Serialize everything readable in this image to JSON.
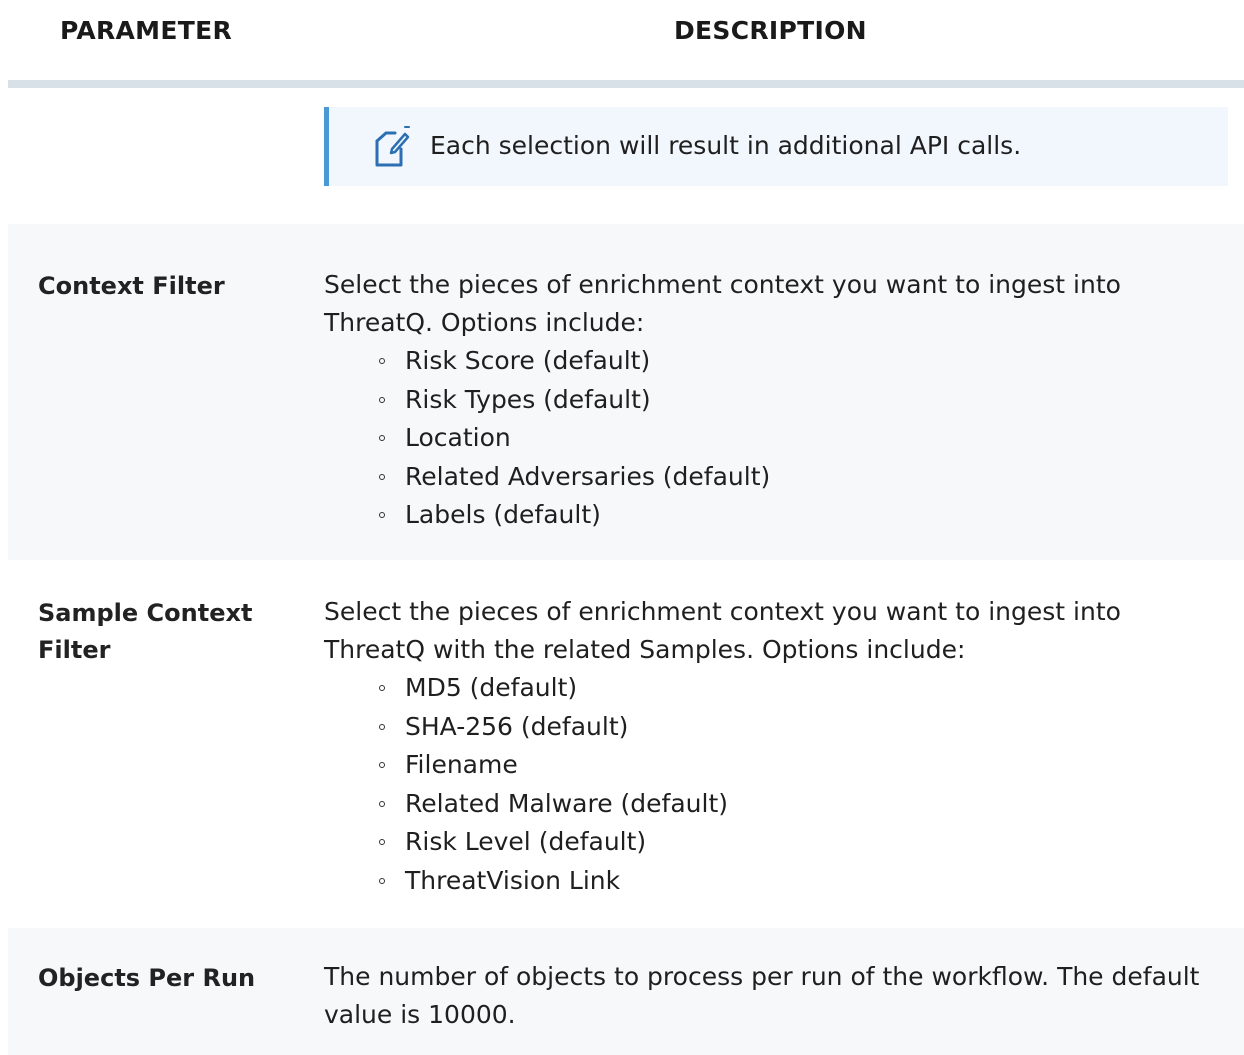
{
  "header": {
    "parameter": "PARAMETER",
    "description": "DESCRIPTION"
  },
  "note": {
    "icon": "note-edit-icon",
    "text": "Each selection will result in additional API calls."
  },
  "colors": {
    "note_border": "#4a98d6",
    "note_background": "#f1f7fc",
    "row_shade": "#f6f8fa",
    "header_rule": "#d9e1e8"
  },
  "rows": [
    {
      "parameter": "Context Filter",
      "description": "Select the pieces of enrichment context you want to ingest into ThreatQ.  Options include:",
      "options": [
        "Risk Score (default)",
        "Risk Types (default)",
        "Location",
        "Related Adversaries (default)",
        "Labels (default)"
      ]
    },
    {
      "parameter": "Sample Context Filter",
      "description": "Select the pieces of enrichment context you want to ingest into ThreatQ with the related Samples.  Options include:",
      "options": [
        "MD5 (default)",
        "SHA-256 (default)",
        "Filename",
        "Related Malware (default)",
        "Risk Level (default)",
        "ThreatVision Link"
      ]
    },
    {
      "parameter": "Objects Per Run",
      "description": "The number of objects to process per run of the workflow.   The default value is 10000.",
      "options": []
    }
  ]
}
